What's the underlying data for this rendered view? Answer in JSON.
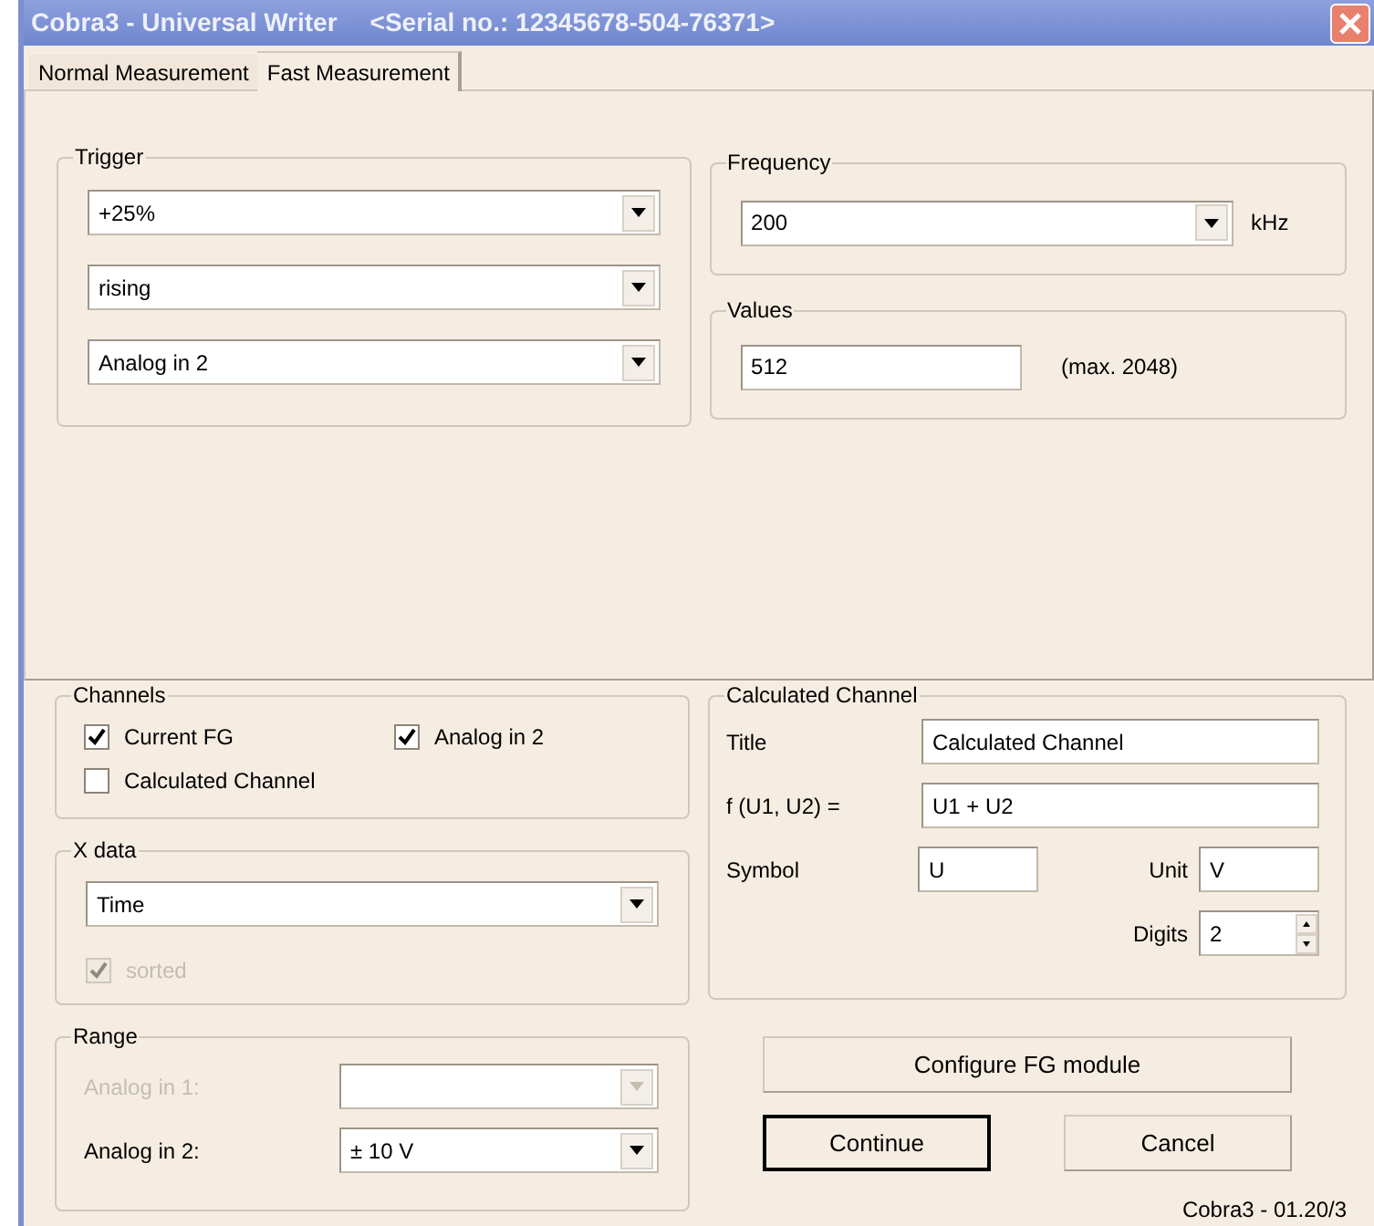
{
  "window": {
    "title": "Cobra3 - Universal Writer",
    "serial": "<Serial no.: 12345678-504-76371>"
  },
  "tabs": [
    {
      "label": "Normal Measurement",
      "selected": false
    },
    {
      "label": "Fast Measurement",
      "selected": true
    }
  ],
  "trigger": {
    "title": "Trigger",
    "dropdowns": [
      "+25%",
      "rising",
      "Analog in 2"
    ]
  },
  "frequency": {
    "title": "Frequency",
    "value": "200",
    "unit": "kHz"
  },
  "values": {
    "title": "Values",
    "value": "512",
    "hint": "(max. 2048)"
  },
  "channels": {
    "title": "Channels",
    "items": [
      {
        "label": "Current FG",
        "checked": true
      },
      {
        "label": "Analog in 2",
        "checked": true
      },
      {
        "label": "Calculated Channel",
        "checked": false
      }
    ]
  },
  "x_data": {
    "title": "X data",
    "value": "Time",
    "sorted": {
      "label": "sorted",
      "checked": true,
      "disabled": true
    }
  },
  "range": {
    "title": "Range",
    "rows": [
      {
        "label": "Analog in 1:",
        "disabled": true
      },
      {
        "label": "Analog in 2:",
        "value": "± 10 V",
        "disabled": false
      }
    ]
  },
  "calculated_channel": {
    "title": "Calculated Channel",
    "title_label": "Title",
    "title_value": "Calculated Channel",
    "formula_label": "f (U1, U2) =",
    "formula_value": "U1 + U2",
    "symbol_label": "Symbol",
    "symbol_value": "U",
    "unit_label": "Unit",
    "unit_value": "V",
    "digits_label": "Digits",
    "digits_value": "2"
  },
  "buttons": [
    {
      "label": "Configure FG module",
      "default": false
    },
    {
      "label": "Continue",
      "default": true
    },
    {
      "label": "Cancel",
      "default": false
    }
  ],
  "version": "Cobra3 - 01.20/3"
}
